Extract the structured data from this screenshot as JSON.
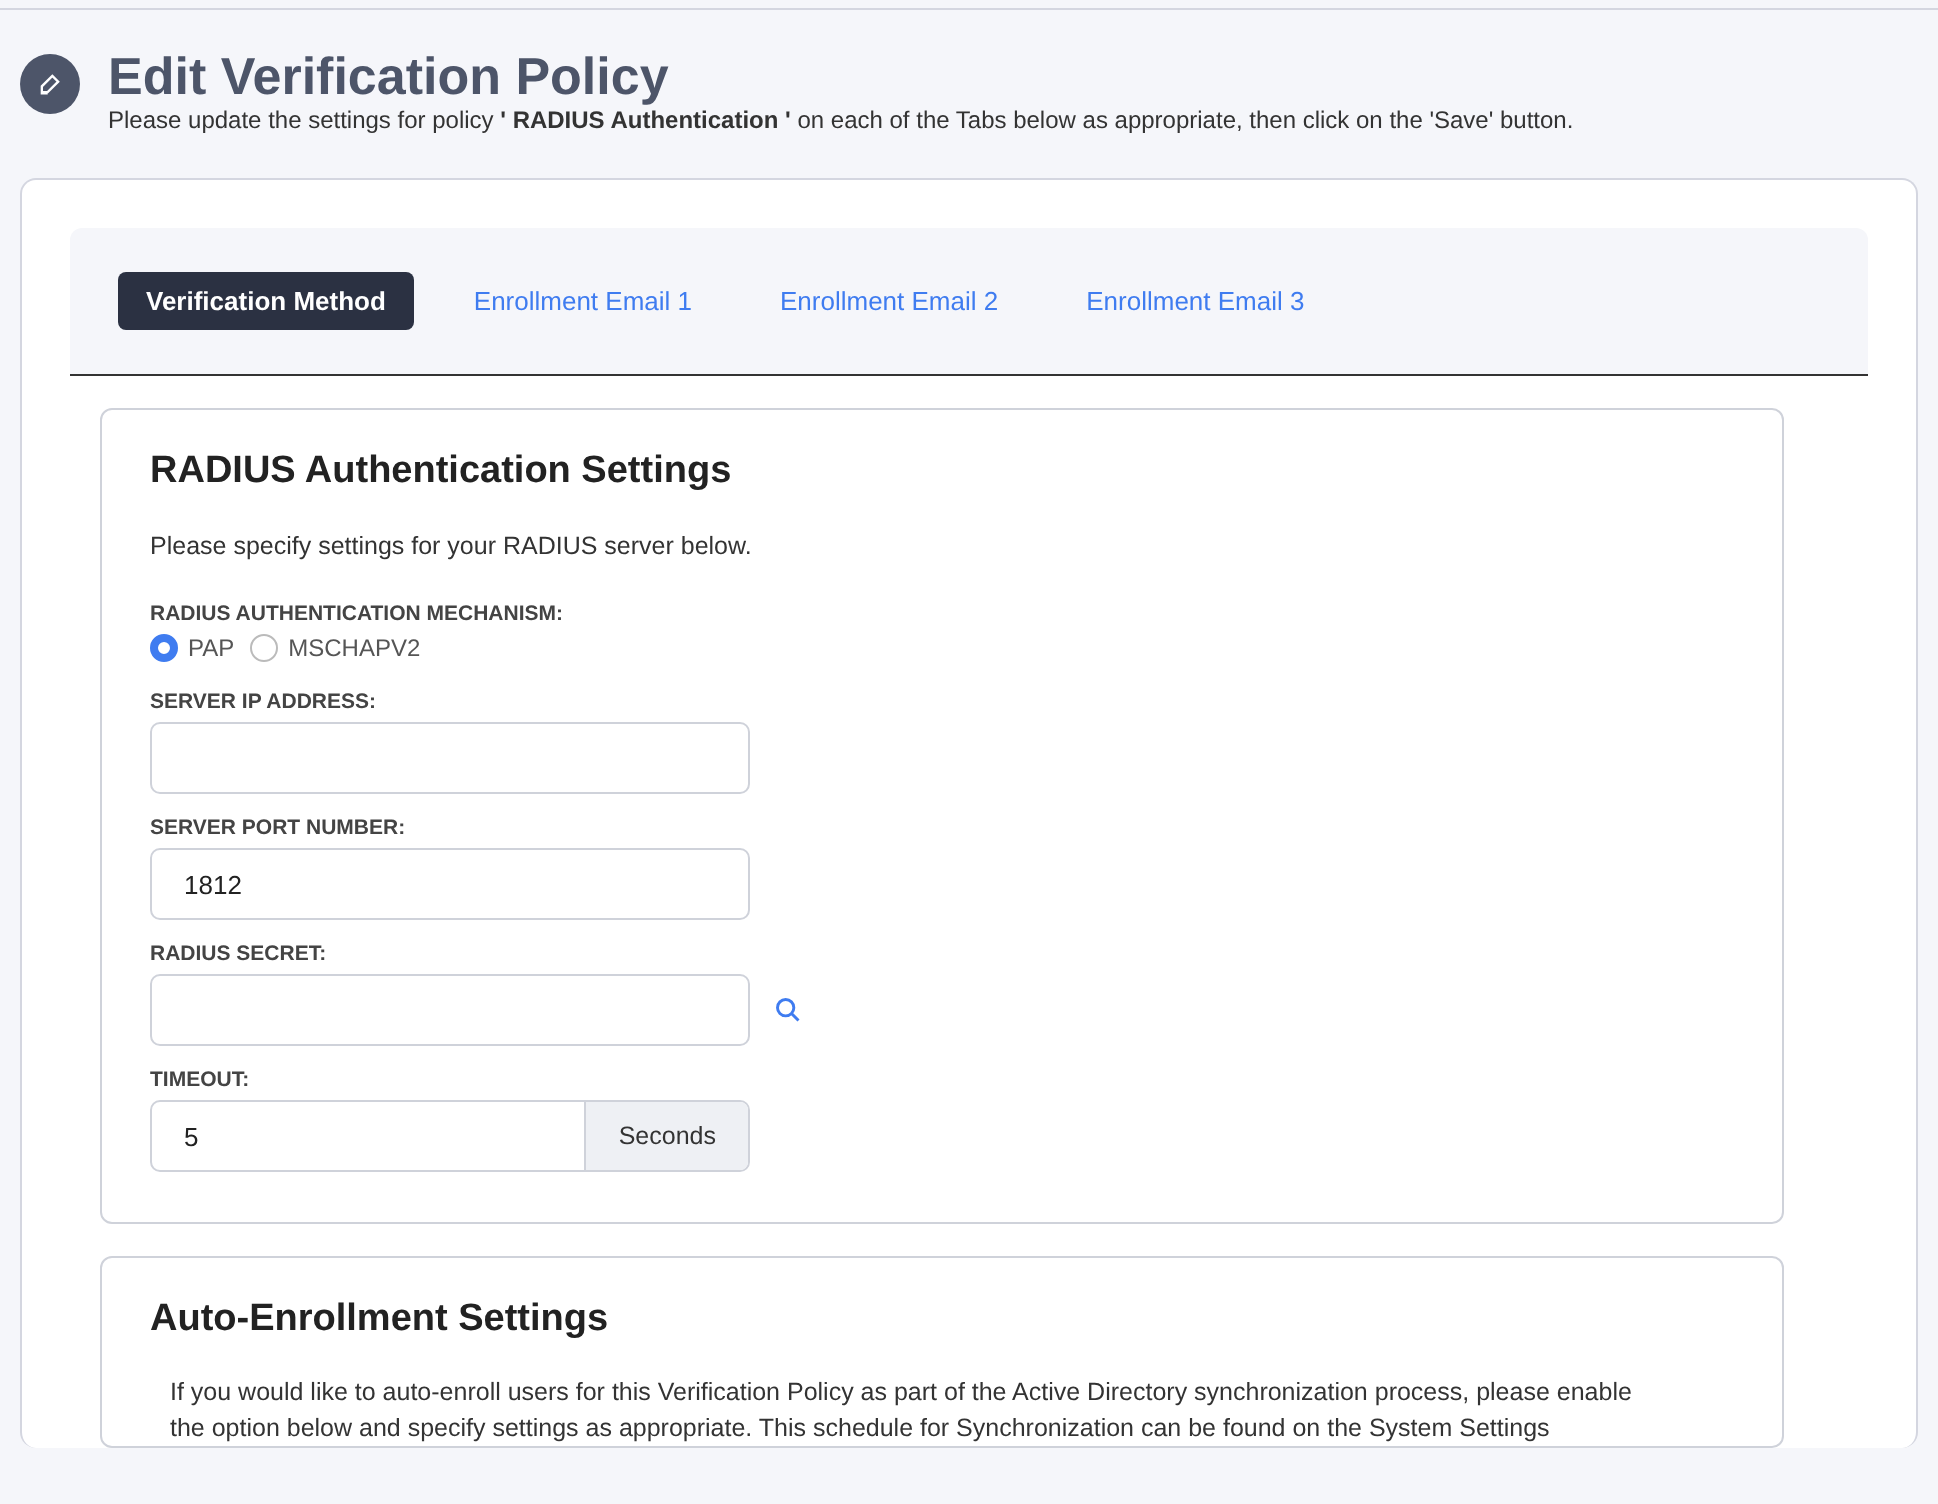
{
  "header": {
    "title": "Edit Verification Policy",
    "subtitle": "Please update the settings for policy **' RADIUS Authentication '** on each of the Tabs below as appropriate, then click on the 'Save' button."
  },
  "tabs": [
    {
      "label": "Verification Method",
      "selected": true
    },
    {
      "label": "Enrollment Email 1",
      "selected": false
    },
    {
      "label": "Enrollment Email 2",
      "selected": false
    },
    {
      "label": "Enrollment Email 3",
      "selected": false
    }
  ],
  "radius_settings": {
    "title": "RADIUS Authentication Settings",
    "description": "Please specify settings for your RADIUS server below.",
    "mechanism": {
      "label": "RADIUS AUTHENTICATION MECHANISM:",
      "options": [
        {
          "label": "PAP",
          "selected": true
        },
        {
          "label": "MSCHAPV2",
          "selected": false
        }
      ]
    },
    "fields": [
      {
        "kind": "plain",
        "label": "SERVER IP ADDRESS:"
      },
      {
        "kind": "plain",
        "label": "SERVER PORT NUMBER:",
        "value": "1812"
      },
      {
        "kind": "icon",
        "label": "RADIUS SECRET:"
      },
      {
        "kind": "addon",
        "label": "TIMEOUT:",
        "value": "5",
        "addon": "Seconds"
      }
    ]
  },
  "auto_enrollment": {
    "title": "Auto-Enrollment Settings",
    "description": "If you would like to auto-enroll users for this Verification Policy as part of the Active Directory synchronization process, please enable the option below and specify settings as appropriate. This schedule for Synchronization can be found on the System Settings"
  }
}
